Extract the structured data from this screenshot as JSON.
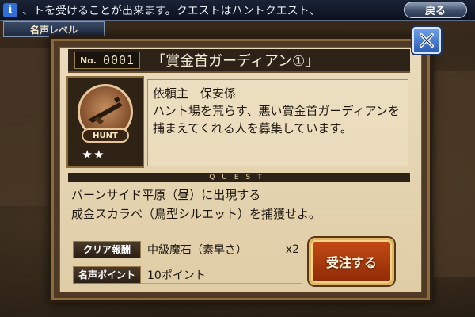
{
  "top_bar": {
    "info_icon": "i",
    "ticker_text": "、トを受けることが出来ます。クエストはハントクエスト、",
    "back_label": "戻る"
  },
  "fame_tab": {
    "label": "名声レベル"
  },
  "quest": {
    "no_label": "No.",
    "no_value": "0001",
    "title": "「賞金首ガーディアン①」",
    "emblem_badge": "HUNT",
    "stars": "★★",
    "client_line": "依頼主　保安係",
    "client_desc": "ハント場を荒らす、悪い賞金首ガーディアンを捕まえてくれる人を募集しています。",
    "divider_label": "QUEST",
    "objective": "バーンサイド平原（昼）に出現する\n成金スカラベ（鳥型シルエット）を捕獲せよ。"
  },
  "rewards": [
    {
      "label": "クリア報酬",
      "value": "中級魔石（素早さ）",
      "qty": "x2"
    },
    {
      "label": "名声ポイント",
      "value": "10ポイント",
      "qty": ""
    }
  ],
  "accept_label": "受注する",
  "icons": {
    "close": "close-x-icon",
    "info": "info-icon",
    "emblem": "rifle-emblem-icon"
  },
  "colors": {
    "accent_blue": "#2f6fd6",
    "accept_orange": "#c44b14",
    "parchment": "#e9dbbb"
  }
}
